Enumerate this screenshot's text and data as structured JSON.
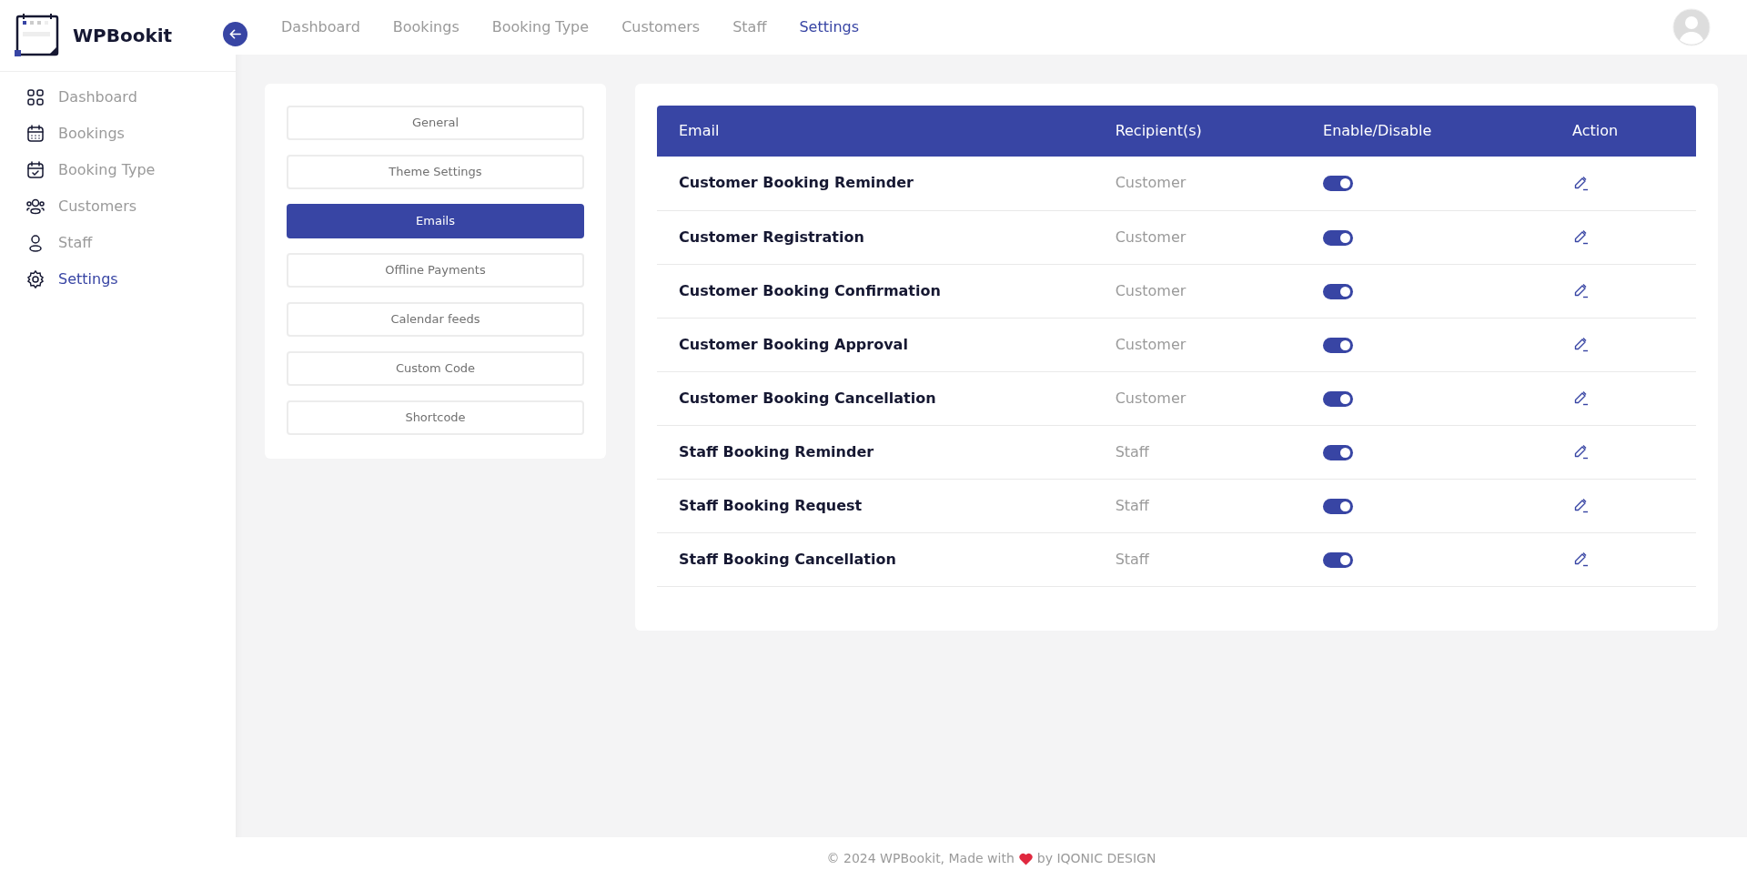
{
  "brand": {
    "name": "WPBookit"
  },
  "sidebar": {
    "items": [
      {
        "label": "Dashboard",
        "selected": false
      },
      {
        "label": "Bookings",
        "selected": false
      },
      {
        "label": "Booking Type",
        "selected": false
      },
      {
        "label": "Customers",
        "selected": false
      },
      {
        "label": "Staff",
        "selected": false
      },
      {
        "label": "Settings",
        "selected": true
      }
    ]
  },
  "top_nav": {
    "items": [
      {
        "label": "Dashboard",
        "selected": false
      },
      {
        "label": "Bookings",
        "selected": false
      },
      {
        "label": "Booking Type",
        "selected": false
      },
      {
        "label": "Customers",
        "selected": false
      },
      {
        "label": "Staff",
        "selected": false
      },
      {
        "label": "Settings",
        "selected": true
      }
    ]
  },
  "settings_menu": [
    {
      "label": "General",
      "selected": false
    },
    {
      "label": "Theme Settings",
      "selected": false
    },
    {
      "label": "Emails",
      "selected": true
    },
    {
      "label": "Offline Payments",
      "selected": false
    },
    {
      "label": "Calendar feeds",
      "selected": false
    },
    {
      "label": "Custom Code",
      "selected": false
    },
    {
      "label": "Shortcode",
      "selected": false
    }
  ],
  "table": {
    "columns": [
      "Email",
      "Recipient(s)",
      "Enable/Disable",
      "Action"
    ],
    "rows": [
      {
        "email": "Customer Booking Reminder",
        "recipient": "Customer",
        "on": true
      },
      {
        "email": "Customer Registration",
        "recipient": "Customer",
        "on": true
      },
      {
        "email": "Customer Booking Confirmation",
        "recipient": "Customer",
        "on": true
      },
      {
        "email": "Customer Booking Approval",
        "recipient": "Customer",
        "on": true
      },
      {
        "email": "Customer Booking Cancellation",
        "recipient": "Customer",
        "on": true
      },
      {
        "email": "Staff Booking Reminder",
        "recipient": "Staff",
        "on": true
      },
      {
        "email": "Staff Booking Request",
        "recipient": "Staff",
        "on": true
      },
      {
        "email": "Staff Booking Cancellation",
        "recipient": "Staff",
        "on": true
      }
    ]
  },
  "footer": {
    "before": "© 2024 WPBookit, Made with",
    "after": "by IQONIC DESIGN"
  }
}
